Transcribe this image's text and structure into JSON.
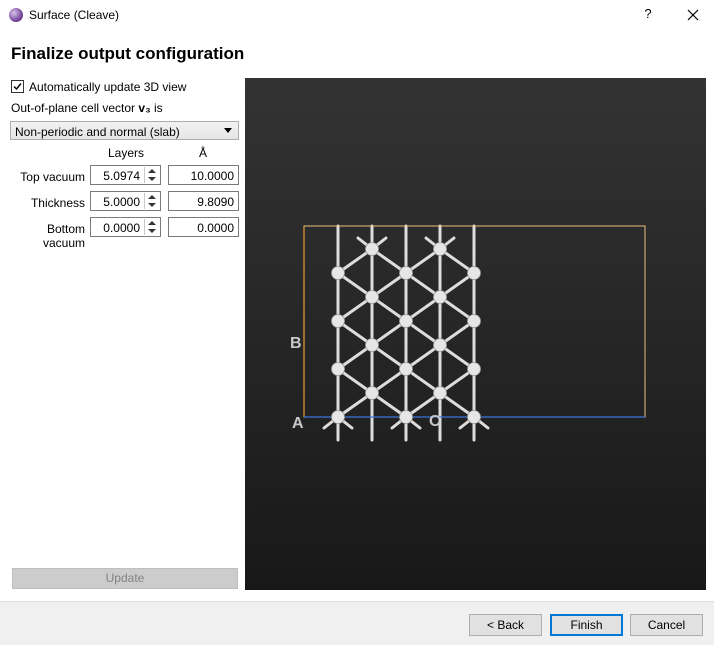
{
  "window": {
    "title": "Surface (Cleave)",
    "help": "?"
  },
  "heading": "Finalize output configuration",
  "auto_update": {
    "label": "Automatically update 3D view",
    "checked": true
  },
  "out_of_plane": {
    "label_prefix": "Out-of-plane cell vector ",
    "vector": "v₃",
    "label_suffix": " is"
  },
  "slab_select": {
    "value": "Non-periodic and normal (slab)"
  },
  "columns": {
    "layers": "Layers",
    "angstrom": "Å"
  },
  "rows": [
    {
      "label": "Top vacuum",
      "layers": "5.0974",
      "angstrom": "10.0000"
    },
    {
      "label": "Thickness",
      "layers": "5.0000",
      "angstrom": "9.8090"
    },
    {
      "label": "Bottom vacuum",
      "layers": "0.0000",
      "angstrom": "0.0000"
    }
  ],
  "update_button": "Update",
  "viewer": {
    "axis_labels": {
      "b": "B",
      "a": "A",
      "c": "C"
    },
    "colors": {
      "cell_box": "#e8c07a",
      "b_axis": "#e8a030",
      "c_axis": "#3a78d8",
      "atom": "#e6e6e6",
      "bond": "#dddddd"
    }
  },
  "buttons": {
    "back": "< Back",
    "finish": "Finish",
    "cancel": "Cancel"
  }
}
